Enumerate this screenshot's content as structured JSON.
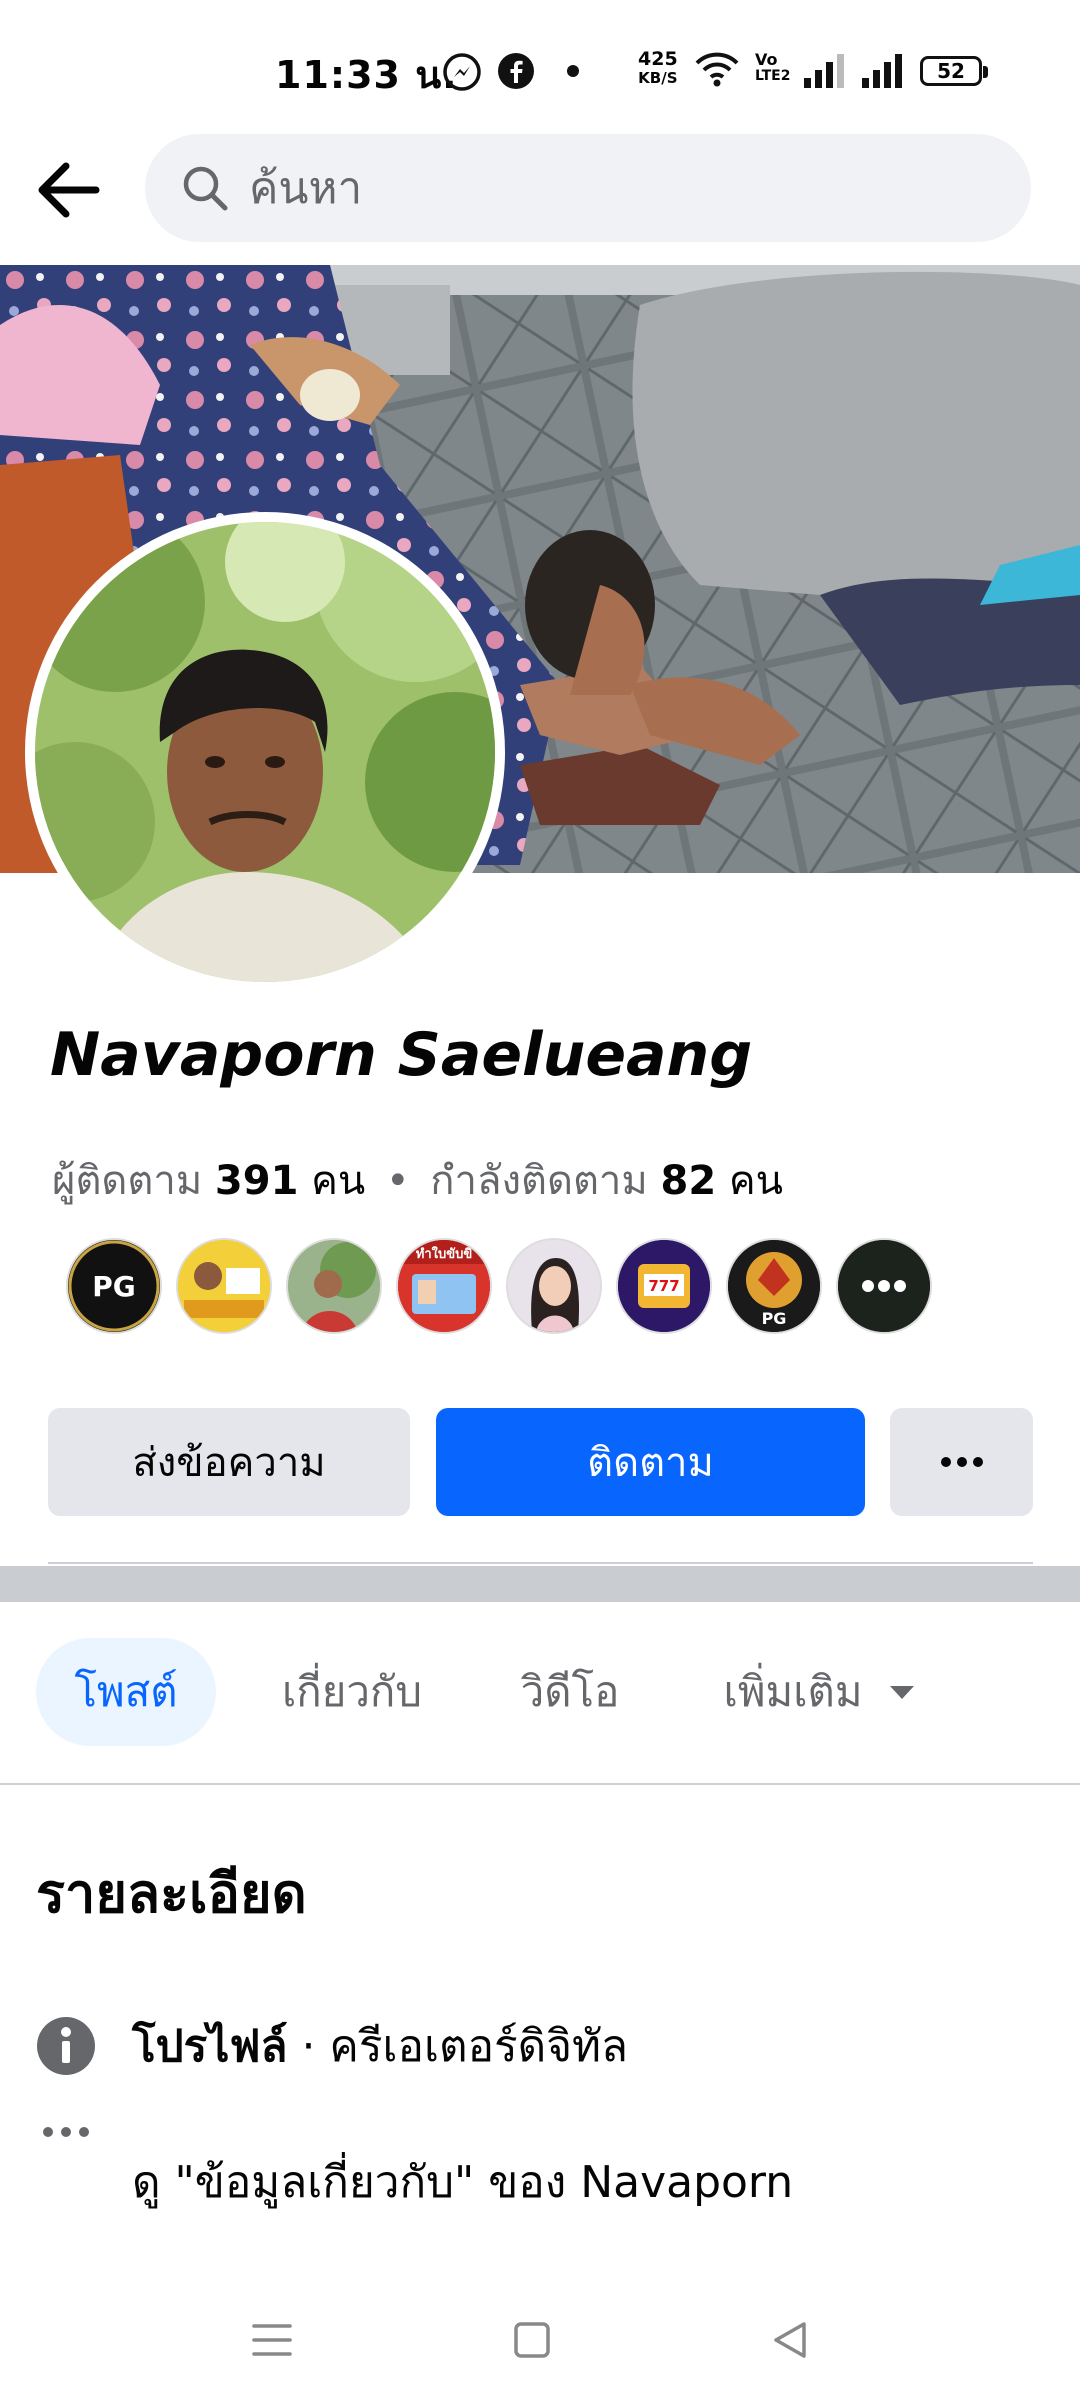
{
  "status_bar": {
    "time": "11:33 น.",
    "net_speed_value": "425",
    "net_speed_unit": "KB/S",
    "volte_top": "Vo",
    "volte_bottom": "LTE2",
    "battery": "52"
  },
  "search": {
    "placeholder": "ค้นหา"
  },
  "profile": {
    "name": "Navaporn Saelueang",
    "followers_label": "ผู้ติดตาม",
    "followers_count": "391",
    "followers_unit": "คน",
    "separator": "•",
    "following_label": "กำลังติดตาม",
    "following_count": "82",
    "following_unit": "คน"
  },
  "followed_avatars": [
    {
      "label": "PG"
    },
    {
      "label": ""
    },
    {
      "label": ""
    },
    {
      "label": "ทำใบขับขี่"
    },
    {
      "label": ""
    },
    {
      "label": "777"
    },
    {
      "label": "PG"
    },
    {
      "label": "•••"
    }
  ],
  "actions": {
    "message_label": "ส่งข้อความ",
    "follow_label": "ติดตาม",
    "more_label": "•••"
  },
  "tabs": [
    {
      "label": "โพสต์",
      "active": true
    },
    {
      "label": "เกี่ยวกับ",
      "active": false
    },
    {
      "label": "วิดีโอ",
      "active": false
    },
    {
      "label": "เพิ่มเติม",
      "active": false
    }
  ],
  "details": {
    "title": "รายละเอียด",
    "profile_type_label": "โปรไฟล์",
    "profile_type_sep": " · ",
    "profile_type_value": "ครีเอเตอร์ดิจิทัล",
    "about_link": "ดู \"ข้อมูลเกี่ยวกับ\" ของ Navaporn"
  },
  "colors": {
    "accent": "#0866ff",
    "button_gray": "#e4e6eb",
    "tab_active_bg": "#ebf5ff",
    "secondary_text": "#65676b"
  }
}
